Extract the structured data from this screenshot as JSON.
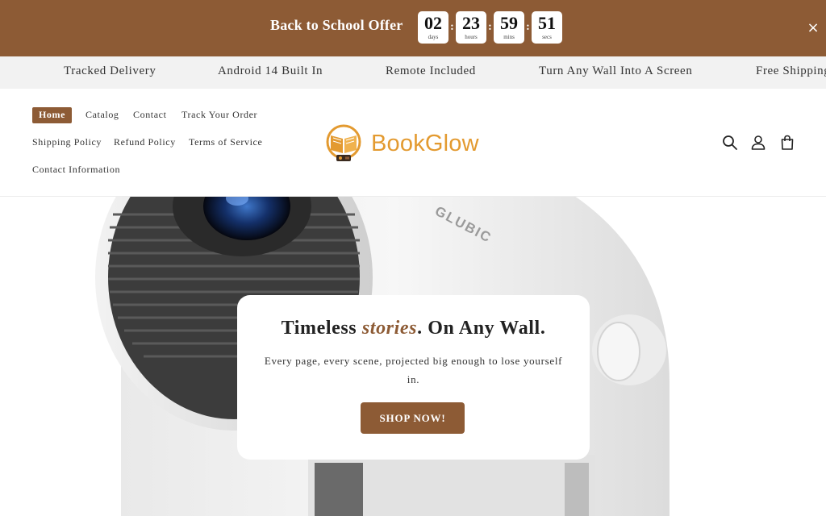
{
  "promo": {
    "title": "Back to School Offer",
    "countdown": [
      {
        "value": "02",
        "unit": "days"
      },
      {
        "value": "23",
        "unit": "hours"
      },
      {
        "value": "59",
        "unit": "mins"
      },
      {
        "value": "51",
        "unit": "secs"
      }
    ],
    "separator": ":",
    "close_icon": "×",
    "background": "#8d5b35"
  },
  "marquee": {
    "items": [
      "Tracked Delivery",
      "Android 14 Built In",
      "Remote Included",
      "Turn Any Wall Into A Screen",
      "Free Shipping"
    ]
  },
  "nav": {
    "items": [
      "Home",
      "Catalog",
      "Contact",
      "Track Your Order",
      "Shipping Policy",
      "Refund Policy",
      "Terms of Service",
      "Contact Information"
    ],
    "active": "Home"
  },
  "logo": {
    "text": "BookGlow",
    "icon": "book-projector-icon",
    "color": "#e39a30"
  },
  "header_icons": [
    "search-icon",
    "account-icon",
    "cart-icon"
  ],
  "hero": {
    "title_start": "Timeless ",
    "title_emphasis": "stories",
    "title_end": ". On Any Wall.",
    "subtitle": "Every page, every scene, projected big enough to lose yourself in.",
    "cta": "SHOP NOW!",
    "product_brand_text": "GLUBIC"
  }
}
